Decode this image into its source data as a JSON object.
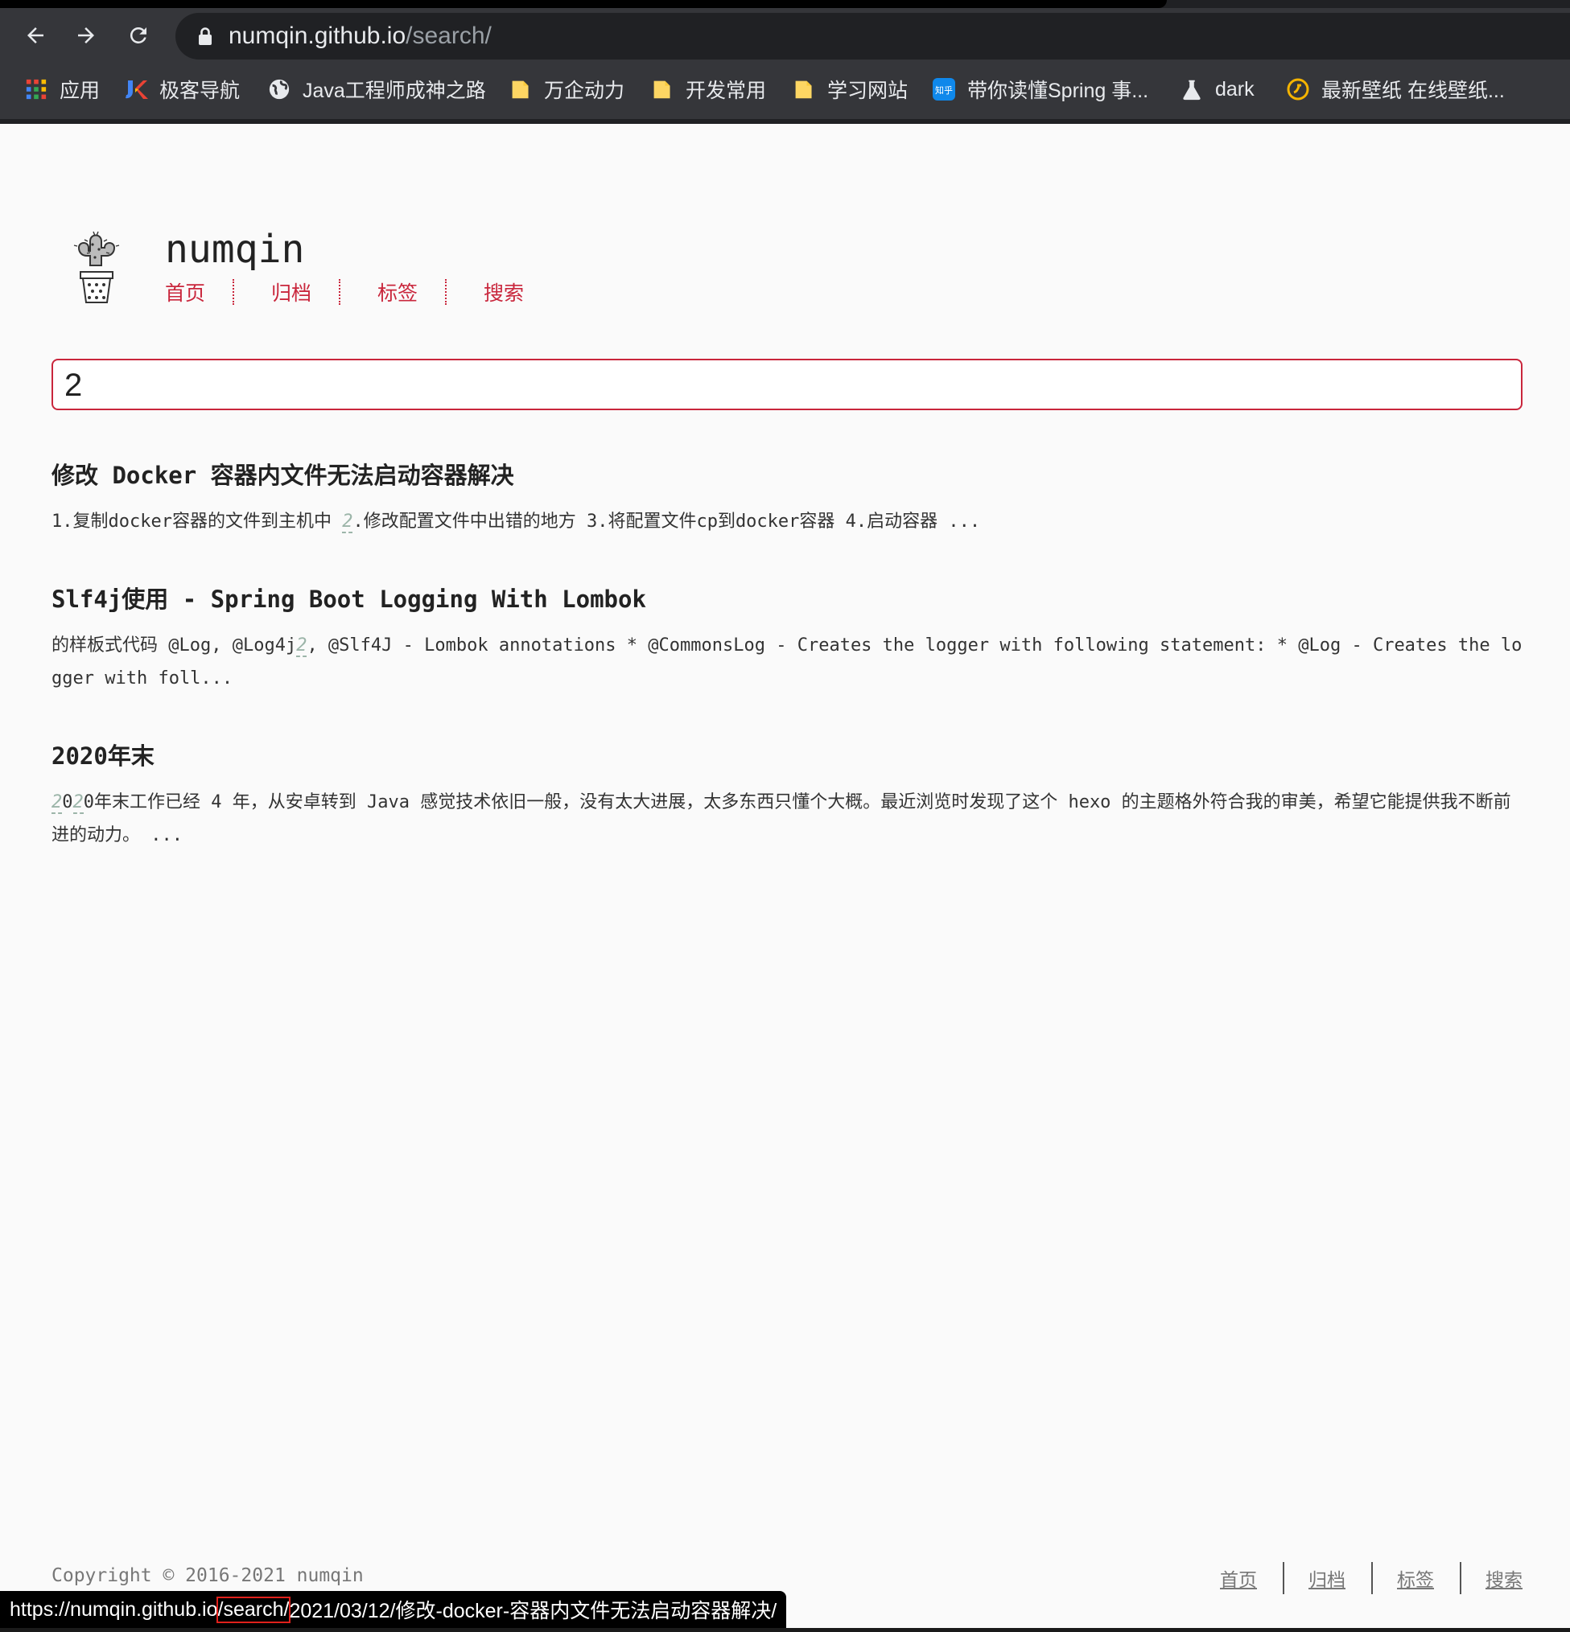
{
  "browser": {
    "url_host": "numqin.github.io",
    "url_path": "/search/",
    "bookmarks": [
      {
        "label": "应用",
        "icon": "apps-grid-icon"
      },
      {
        "label": "极客导航",
        "icon": "geek-nav-icon"
      },
      {
        "label": "Java工程师成神之路",
        "icon": "globe-icon"
      },
      {
        "label": "万企动力",
        "icon": "folder-icon"
      },
      {
        "label": "开发常用",
        "icon": "folder-icon"
      },
      {
        "label": "学习网站",
        "icon": "folder-icon"
      },
      {
        "label": "带你读懂Spring 事...",
        "icon": "zhihu-icon"
      },
      {
        "label": "dark",
        "icon": "flask-icon"
      },
      {
        "label": "最新壁纸 在线壁纸...",
        "icon": "wallpaper-icon"
      }
    ],
    "status_url": {
      "host": "https://numqin.github.io",
      "boxed": "/search/",
      "rest": "2021/03/12/修改-docker-容器内文件无法启动容器解决/"
    }
  },
  "site": {
    "title": "numqin",
    "nav": [
      "首页",
      "归档",
      "标签",
      "搜索"
    ]
  },
  "search": {
    "value": "2"
  },
  "results": [
    {
      "title": "修改 Docker 容器内文件无法启动容器解决",
      "excerpt_parts": [
        {
          "text": "1.复制docker容器的文件到主机中 "
        },
        {
          "text": "2",
          "hl": true
        },
        {
          "text": ".修改配置文件中出错的地方 3.将配置文件cp到docker容器 4.启动容器 ..."
        }
      ]
    },
    {
      "title": "Slf4j使用 - Spring Boot Logging With Lombok",
      "excerpt_parts": [
        {
          "text": "的样板式代码 @Log, @Log4j"
        },
        {
          "text": "2",
          "hl": true
        },
        {
          "text": ", @Slf4J - Lombok annotations * @CommonsLog - Creates the logger with following statement: * @Log - Creates the logger with foll..."
        }
      ]
    },
    {
      "title": "2020年末",
      "excerpt_parts": [
        {
          "text": "2",
          "hl": true
        },
        {
          "text": "0"
        },
        {
          "text": "2",
          "hl": true
        },
        {
          "text": "0年末工作已经 4 年，从安卓转到 Java 感觉技术依旧一般，没有太大进展，太多东西只懂个大概。最近浏览时发现了这个 hexo 的主题格外符合我的审美，希望它能提供我不断前进的动力。 ..."
        }
      ]
    }
  ],
  "footer": {
    "copyright": "Copyright © 2016-2021 numqin",
    "nav": [
      "首页",
      "归档",
      "标签",
      "搜索"
    ]
  },
  "colors": {
    "accent": "#c9263c",
    "highlight": "#9cb5a9"
  }
}
